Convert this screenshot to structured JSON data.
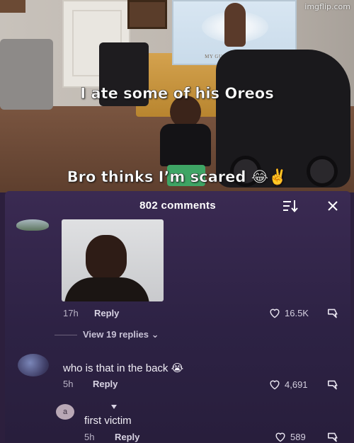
{
  "watermark": "imgflip.com",
  "meme": {
    "top_text": "I ate some of his Oreos",
    "bottom_text": "Bro thinks I’m scared 😂✌️",
    "poster_caption": "MY GUARDIAN ANGEL"
  },
  "comments_panel": {
    "count_label": "802 comments",
    "sort_icon": "sort-icon",
    "close_icon": "close-icon",
    "comments": [
      {
        "image_description": "mugshot",
        "time": "17h",
        "reply_label": "Reply",
        "likes": "16.5K",
        "view_replies": "View 19 replies"
      },
      {
        "text": "who is that in the back 😭",
        "time": "5h",
        "reply_label": "Reply",
        "likes": "4,691"
      },
      {
        "avatar_letter": "a",
        "text": "first victim",
        "time": "5h",
        "reply_label": "Reply",
        "likes": "589"
      }
    ]
  },
  "colors": {
    "panel_bg": "#3a2a52",
    "text_muted": "#b9b3c6",
    "accent_shorts": "#3ea565"
  }
}
